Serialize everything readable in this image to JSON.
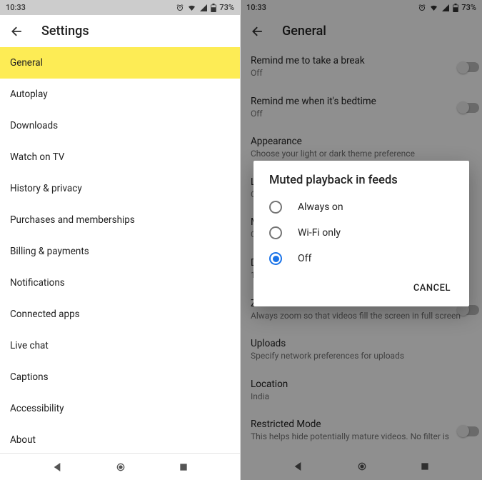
{
  "status": {
    "time": "10:33",
    "battery": "73%"
  },
  "left": {
    "title": "Settings",
    "items": [
      "General",
      "Autoplay",
      "Downloads",
      "Watch on TV",
      "History & privacy",
      "Purchases and memberships",
      "Billing & payments",
      "Notifications",
      "Connected apps",
      "Live chat",
      "Captions",
      "Accessibility",
      "About"
    ]
  },
  "right": {
    "title": "General",
    "settings": [
      {
        "title": "Remind me to take a break",
        "sub": "Off",
        "toggle": true
      },
      {
        "title": "Remind me when it's bedtime",
        "sub": "Off",
        "toggle": true
      },
      {
        "title": "Appearance",
        "sub": "Choose your light or dark theme preference",
        "toggle": false
      },
      {
        "title": "L",
        "sub": "O",
        "toggle": false
      },
      {
        "title": "M",
        "sub": "C\nH",
        "toggle": false
      },
      {
        "title": "D",
        "sub": "1",
        "toggle": false
      },
      {
        "title": "Zoom to fill screen",
        "sub": "Always zoom so that videos fill the screen in full screen",
        "toggle": true
      },
      {
        "title": "Uploads",
        "sub": "Specify network preferences for uploads",
        "toggle": false
      },
      {
        "title": "Location",
        "sub": "India",
        "toggle": false
      },
      {
        "title": "Restricted Mode",
        "sub": "This helps hide potentially mature videos. No filter is",
        "toggle": true
      }
    ]
  },
  "dialog": {
    "title": "Muted playback in feeds",
    "options": [
      "Always on",
      "Wi-Fi only",
      "Off"
    ],
    "selected": 2,
    "cancel": "CANCEL"
  }
}
